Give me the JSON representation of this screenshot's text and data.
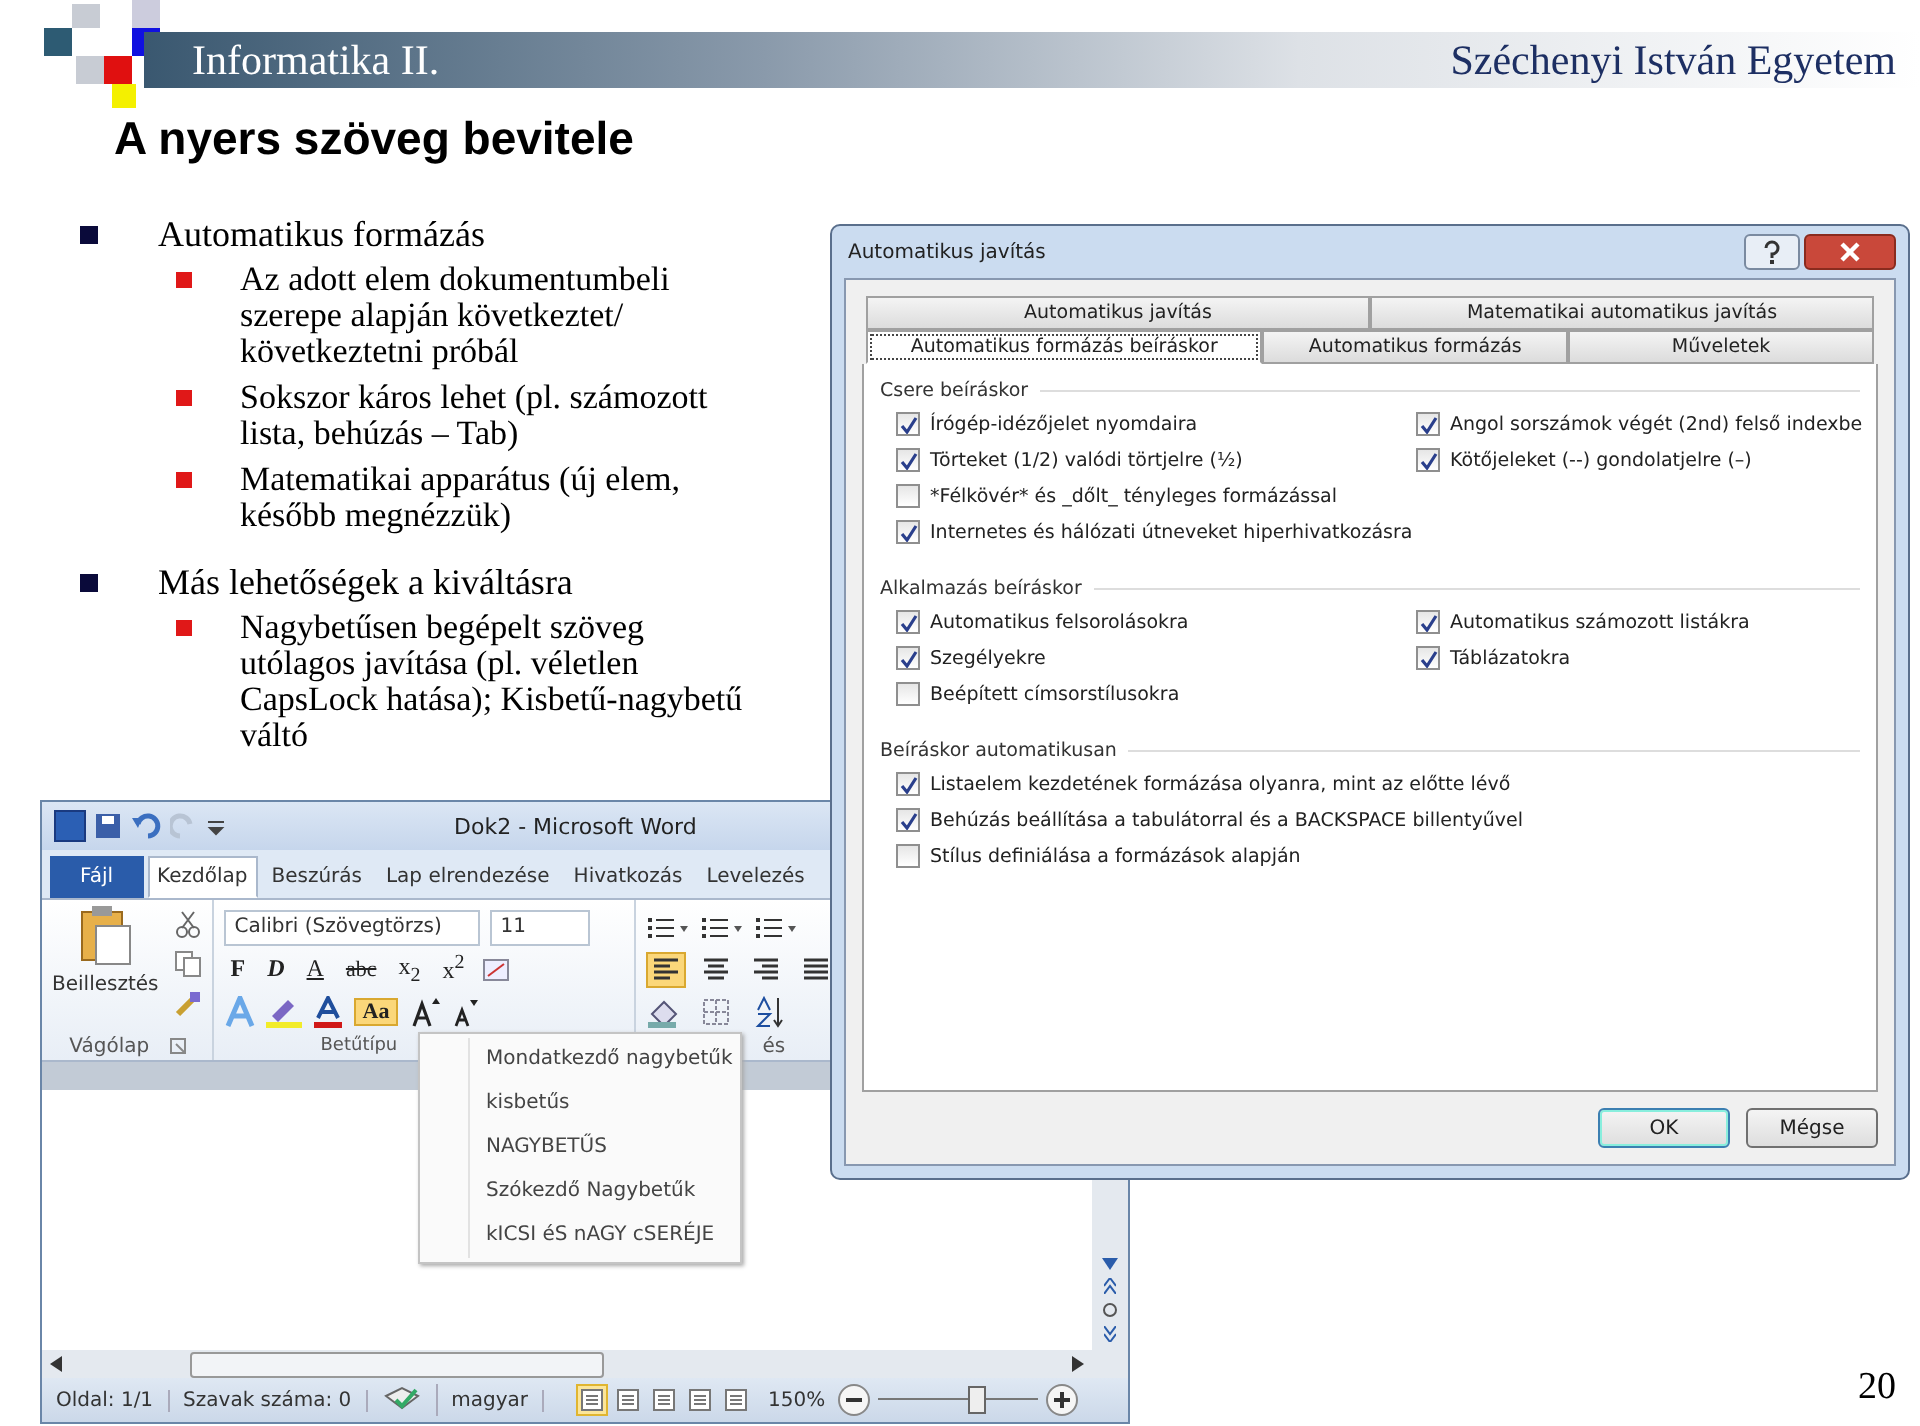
{
  "header": {
    "course": "Informatika II.",
    "university": "Széchenyi István Egyetem"
  },
  "title": "A nyers szöveg bevitele",
  "bullets": [
    {
      "text": "Automatikus formázás",
      "children": [
        {
          "text": "Az adott elem dokumentumbeli szerepe alapján következtet/ következtetni próbál"
        },
        {
          "text": "Sokszor káros lehet (pl. számozott lista, behúzás – Tab)"
        },
        {
          "text": "Matematikai apparátus (új elem, később megnézzük)"
        }
      ]
    },
    {
      "text": "Más lehetőségek a kiváltásra",
      "children": [
        {
          "text": "Nagybetűsen begépelt szöveg utólagos javítása (pl. véletlen CapsLock hatása); Kisbetű-nagybetű váltó"
        }
      ]
    }
  ],
  "word_window": {
    "title": "Dok2 - Microsoft Word",
    "tabs": [
      {
        "label": "Fájl",
        "kind": "file",
        "selected": false
      },
      {
        "label": "Kezdőlap",
        "kind": "tab",
        "selected": true
      },
      {
        "label": "Beszúrás",
        "kind": "tab",
        "selected": false
      },
      {
        "label": "Lap elrendezése",
        "kind": "tab",
        "selected": false
      },
      {
        "label": "Hivatkozás",
        "kind": "tab",
        "selected": false
      },
      {
        "label": "Levelezés",
        "kind": "tab",
        "selected": false
      }
    ],
    "paste_label": "Beillesztés",
    "clipboard_group": "Vágólap",
    "font_group": "Betűtípu",
    "paragraph_group": "és",
    "font_name": "Calibri (Szövegtörzs)",
    "font_size": "11",
    "format_buttons": [
      {
        "label": "F",
        "kind": "bold"
      },
      {
        "label": "D",
        "kind": "italic"
      },
      {
        "label": "A",
        "kind": "underline"
      },
      {
        "label": "abc",
        "kind": "strike"
      },
      {
        "label": "x$_{2}$",
        "kind": "plain"
      },
      {
        "label": "x$^{2}$",
        "kind": "plain"
      }
    ],
    "case_button": {
      "label": "Aa",
      "selected": true
    },
    "align_buttons": [
      {
        "selected": true
      },
      {
        "selected": false
      },
      {
        "selected": false
      },
      {
        "selected": false
      }
    ],
    "case_menu": [
      "Mondatkezdő nagybetűk",
      "kisbetűs",
      "NAGYBETŰS",
      "Szókezdő Nagybetűk",
      "kICSI éS nAGY cSERÉJE"
    ],
    "status": {
      "page": "Oldal: 1/1",
      "words": "Szavak száma: 0",
      "language": "magyar",
      "zoom": "150%",
      "level": 0.6
    },
    "views": [
      {
        "selected": true
      },
      {
        "selected": false
      },
      {
        "selected": false
      },
      {
        "selected": false
      },
      {
        "selected": false
      }
    ]
  },
  "dialog": {
    "title": "Automatikus javítás",
    "tab_rows": [
      [
        {
          "label": "Automatikus javítás",
          "selected": false
        },
        {
          "label": "Matematikai automatikus javítás",
          "selected": false
        }
      ],
      [
        {
          "label": "Automatikus formázás beíráskor",
          "selected": true
        },
        {
          "label": "Automatikus formázás",
          "selected": false
        },
        {
          "label": "Műveletek",
          "selected": false
        }
      ]
    ],
    "sections": [
      {
        "title": "Csere beíráskor",
        "columns": [
          [
            {
              "label": "Írógép-idézőjelet nyomdaira",
              "checked": true
            },
            {
              "label": "Törteket (1/2) valódi törtjelre (½)",
              "checked": true
            },
            {
              "label": "*Félkövér* és _dőlt_ tényleges formázással",
              "checked": false
            },
            {
              "label": "Internetes és hálózati útneveket hiperhivatkozásra",
              "checked": true
            }
          ],
          [
            {
              "label": "Angol sorszámok végét (2nd) felső indexbe",
              "checked": true
            },
            {
              "label": "Kötőjeleket (--) gondolatjelre (–)",
              "checked": true
            }
          ]
        ]
      },
      {
        "title": "Alkalmazás beíráskor",
        "columns": [
          [
            {
              "label": "Automatikus felsorolásokra",
              "checked": true
            },
            {
              "label": "Szegélyekre",
              "checked": true
            },
            {
              "label": "Beépített címsorstílusokra",
              "checked": false
            }
          ],
          [
            {
              "label": "Automatikus számozott listákra",
              "checked": true
            },
            {
              "label": "Táblázatokra",
              "checked": true
            }
          ]
        ]
      },
      {
        "title": "Beíráskor automatikusan",
        "columns": [
          [
            {
              "label": "Listaelem kezdetének formázása olyanra, mint az előtte lévő",
              "checked": true
            },
            {
              "label": "Behúzás beállítása a tabulátorral és a BACKSPACE billentyűvel",
              "checked": true
            },
            {
              "label": "Stílus definiálása a formázások alapján",
              "checked": false
            }
          ]
        ]
      }
    ],
    "buttons": [
      {
        "label": "OK",
        "kind": "default"
      },
      {
        "label": "Mégse",
        "kind": "normal"
      }
    ]
  },
  "page_number": "20"
}
